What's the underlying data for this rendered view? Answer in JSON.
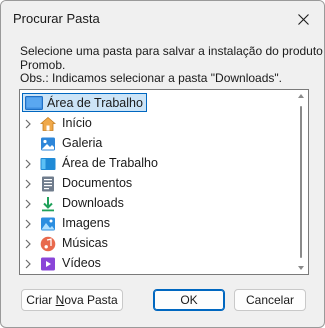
{
  "window": {
    "title": "Procurar Pasta"
  },
  "description": {
    "line1": "Selecione uma pasta para salvar a instalação do produto",
    "line2": "Promob.",
    "line3": "Obs.: Indicamos selecionar a pasta \"Downloads\"."
  },
  "tree": {
    "root": {
      "label": "Área de Trabalho",
      "icon": "desktop-icon"
    },
    "items": [
      {
        "label": "Início",
        "icon": "home-icon",
        "expandable": true
      },
      {
        "label": "Galeria",
        "icon": "gallery-icon",
        "expandable": false
      },
      {
        "label": "Área de Trabalho",
        "icon": "desktop-icon",
        "expandable": true
      },
      {
        "label": "Documentos",
        "icon": "documents-icon",
        "expandable": true
      },
      {
        "label": "Downloads",
        "icon": "downloads-icon",
        "expandable": true
      },
      {
        "label": "Imagens",
        "icon": "pictures-icon",
        "expandable": true
      },
      {
        "label": "Músicas",
        "icon": "music-icon",
        "expandable": true
      },
      {
        "label": "Vídeos",
        "icon": "videos-icon",
        "expandable": true
      }
    ]
  },
  "buttons": {
    "new_folder": "Criar Nova Pasta",
    "new_folder_mnemonic": "N",
    "ok": "OK",
    "cancel": "Cancelar"
  },
  "colors": {
    "accent": "#0067c0",
    "selection_bg": "#cce4f7",
    "dialog_bg": "#f0f0f0"
  }
}
